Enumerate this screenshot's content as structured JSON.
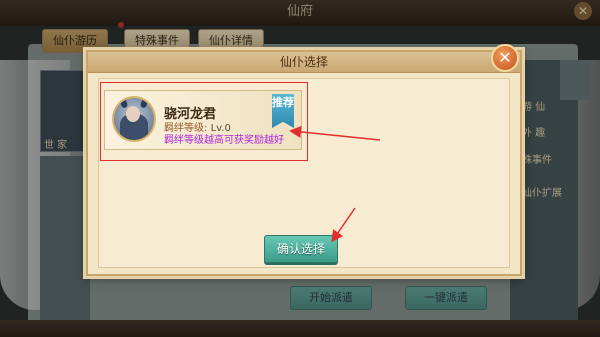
{
  "background": {
    "title": "仙府",
    "tabs": [
      {
        "label": "仙仆游历",
        "active": true
      },
      {
        "label": "特殊事件",
        "active": false
      },
      {
        "label": "仙仆详情",
        "active": false
      }
    ],
    "left_text": "世 家",
    "right_texts": [
      "游 仙",
      "外 趣",
      "殊事件",
      "仙仆扩展",
      "扩"
    ],
    "buttons": [
      "开始派遣",
      "一键派遣"
    ]
  },
  "dialog": {
    "title": "仙仆选择",
    "close_glyph": "✕",
    "candidate": {
      "name": "骁河龙君",
      "level_label": "羁绊等级:",
      "level_value": "Lv.0",
      "hint": "羁绊等级越高可获奖励越好",
      "badge": "推荐"
    },
    "confirm_label": "确认选择"
  },
  "colors": {
    "annotation": "#e12d2d",
    "confirm": "#3c9c89",
    "hint": "#b227d8",
    "badge": "#2f89ae"
  }
}
